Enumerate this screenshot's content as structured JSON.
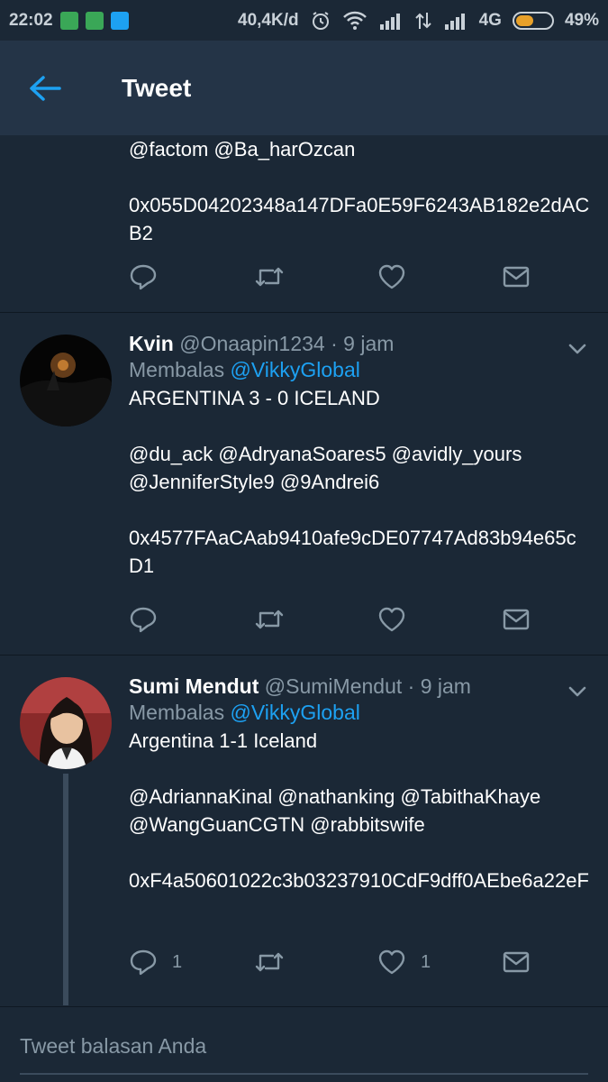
{
  "status_bar": {
    "time": "22:02",
    "net_speed": "40,4K/d",
    "network": "4G",
    "battery": "49%",
    "battery_level": 0.49
  },
  "header": {
    "title": "Tweet",
    "back_icon": "arrow-left-icon"
  },
  "tweets": [
    {
      "mentions": "@factom @Ba_harOzcan",
      "address": "0x055D04202348a147DFa0E59F6243AB182e2dACB2",
      "reply_count": "",
      "like_count": ""
    },
    {
      "name": "Kvin",
      "handle": "@Onaapin1234",
      "time": "9 jam",
      "reply_prefix": "Membalas",
      "reply_to": "@VikkyGlobal",
      "text": "ARGENTINA 3 - 0 ICELAND",
      "mentions": "@du_ack @AdryanaSoares5 @avidly_yours @JenniferStyle9 @9Andrei6",
      "address": "0x4577FAaCAab9410afe9cDE07747Ad83b94e65cD1",
      "reply_count": "",
      "like_count": ""
    },
    {
      "name": "Sumi Mendut",
      "handle": "@SumiMendut",
      "time": "9 jam",
      "reply_prefix": "Membalas",
      "reply_to": "@VikkyGlobal",
      "text": "Argentina 1-1 Iceland",
      "mentions": "@AdriannaKinal @nathanking @TabithaKhaye @WangGuanCGTN @rabbitswife",
      "address": "0xF4a50601022c3b03237910CdF9dff0AEbe6a22eF",
      "reply_count": "1",
      "like_count": "1"
    }
  ],
  "composer": {
    "placeholder": "Tweet balasan Anda"
  },
  "colors": {
    "background": "#1b2836",
    "appbar": "#243447",
    "link": "#1da1f2",
    "muted": "#8899a6"
  },
  "icons": [
    "reply-icon",
    "retweet-icon",
    "like-icon",
    "direct-message-icon",
    "chevron-down-icon"
  ]
}
